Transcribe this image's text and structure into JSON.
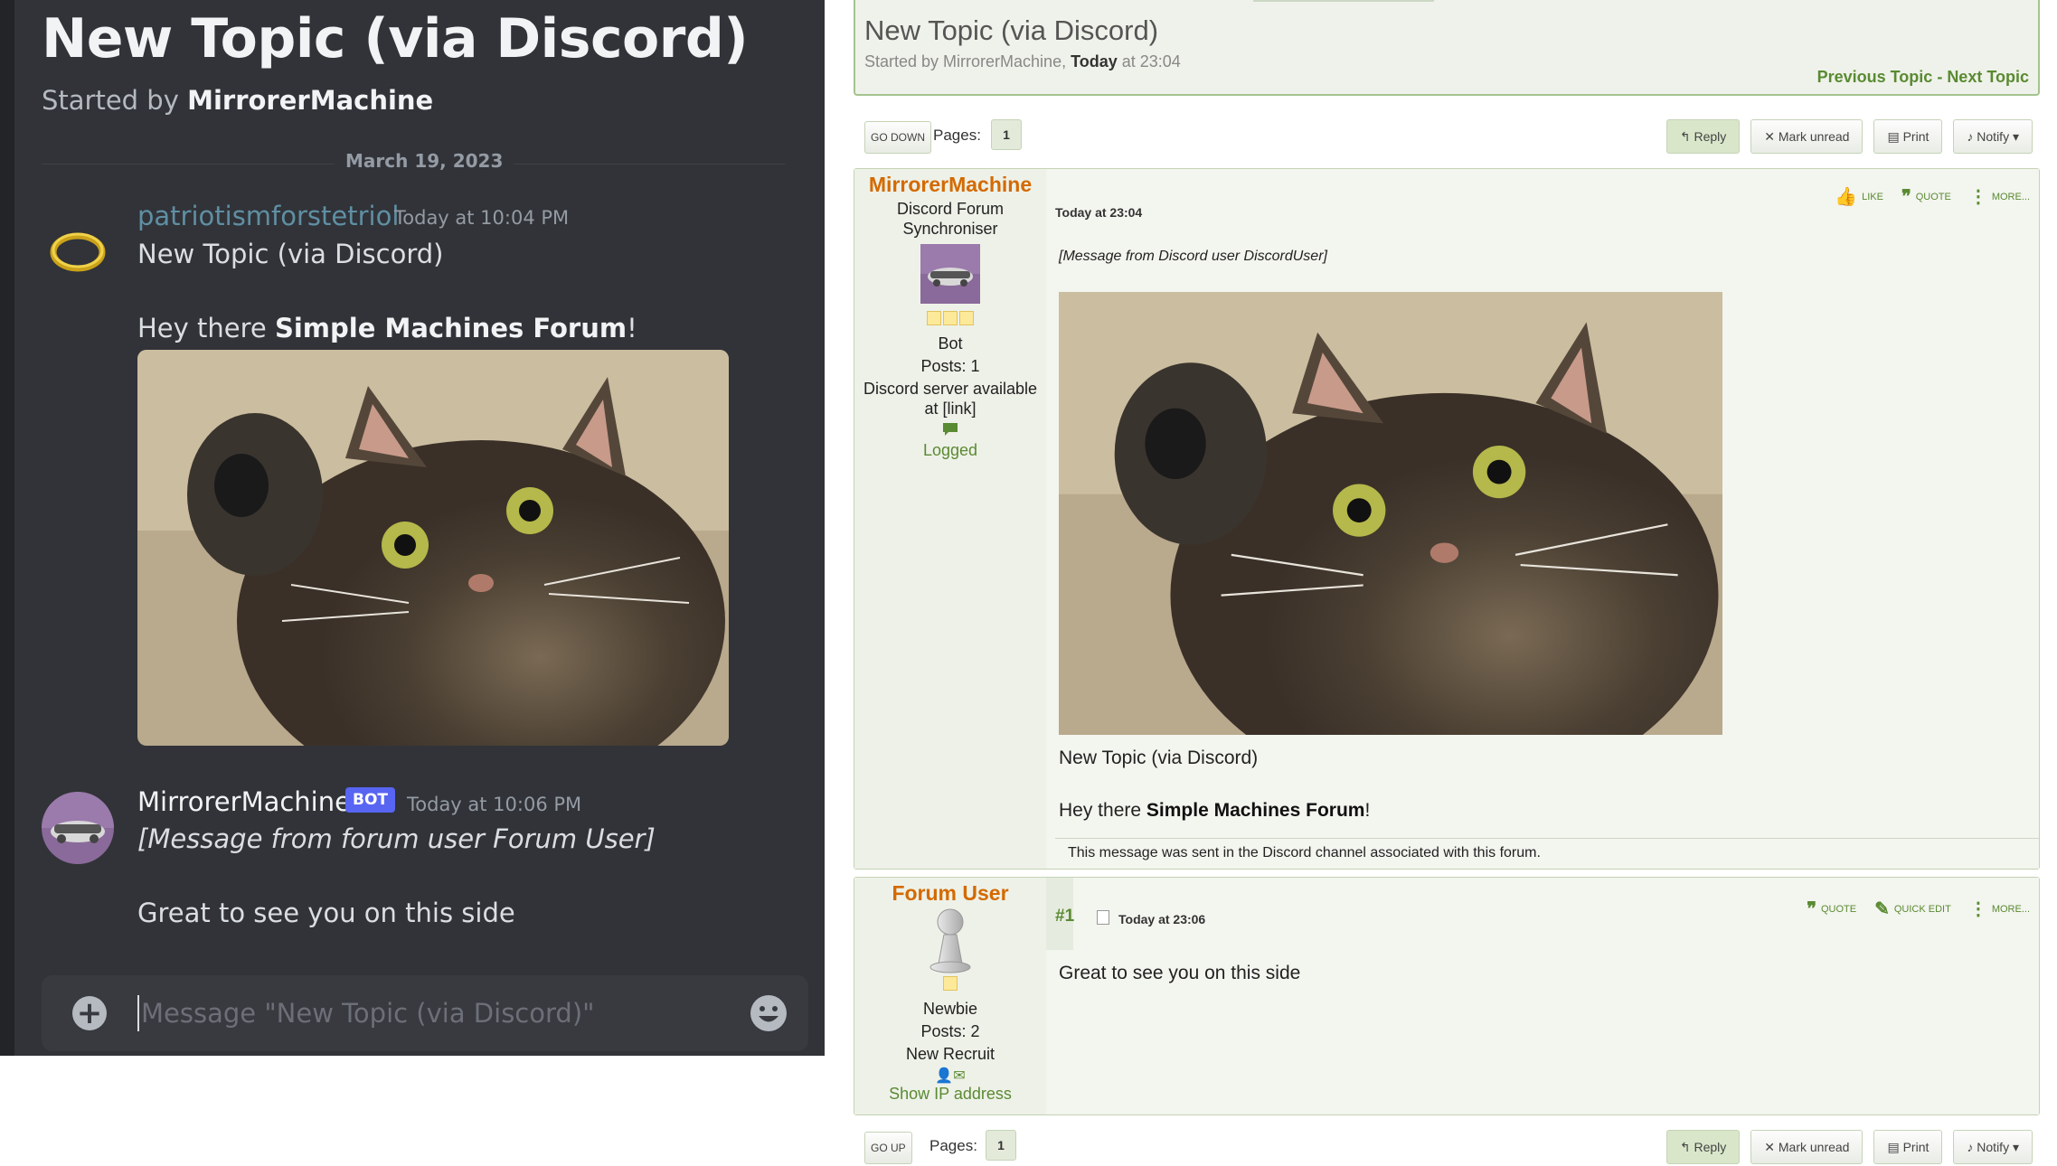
{
  "discord": {
    "title": "New Topic (via Discord)",
    "started_prefix": "Started by ",
    "started_user": "MirrorerMachine",
    "date_divider": "March 19, 2023",
    "messages": [
      {
        "user": "patriotismforstetriol",
        "user_color": "#5f8fa3",
        "time": "Today at 10:04 PM",
        "line1": "New Topic (via Discord)",
        "line2_prefix": "Hey there ",
        "line2_bold": "Simple Machines Forum",
        "line2_suffix": "!",
        "avatar_icon": "ring-icon"
      },
      {
        "user": "MirrorerMachine",
        "user_color": "#f2f3f5",
        "badge": "BOT",
        "time": "Today at 10:06 PM",
        "italic_line": "[Message from forum user Forum User]",
        "text": "Great to see you on this side",
        "avatar_icon": "machine-avatar-icon"
      }
    ],
    "input_placeholder": "Message \"New Topic (via Discord)\""
  },
  "forum": {
    "title": "New Topic (via Discord)",
    "started_prefix": "Started by MirrorerMachine, ",
    "started_bold": "Today",
    "started_suffix": " at 23:04",
    "prev_topic": "Previous Topic",
    "nav_sep": " - ",
    "next_topic": "Next Topic",
    "go_down": "GO DOWN",
    "go_up": "GO UP",
    "pages_label": "Pages:",
    "page_number": "1",
    "actions": {
      "reply": "Reply",
      "mark_unread": "Mark unread",
      "print": "Print",
      "notify": "Notify"
    },
    "post1": {
      "author": "MirrorerMachine",
      "title_line1": "Discord Forum",
      "title_line2": "Synchroniser",
      "group": "Bot",
      "posts": "Posts: 1",
      "sig1": "Discord server available",
      "sig2": "at [link]",
      "status": "Logged",
      "time": "Today at 23:04",
      "like": "LIKE",
      "quote": "QUOTE",
      "more": "MORE...",
      "italic": "[Message from Discord user DiscordUser]",
      "body1": "New Topic (via Discord)",
      "body2_prefix": "Hey there ",
      "body2_bold": "Simple Machines Forum",
      "body2_suffix": "!",
      "footer": "This message was sent in the Discord channel associated with this forum."
    },
    "post2": {
      "author": "Forum User",
      "group": "Newbie",
      "posts": "Posts: 2",
      "rank": "New Recruit",
      "show_ip": "Show IP address",
      "counter": "#1",
      "time": "Today at 23:06",
      "quote": "QUOTE",
      "quick_edit": "QUICK EDIT",
      "more": "MORE...",
      "body": "Great to see you on this side"
    }
  },
  "colors": {
    "discord_bg": "#313338",
    "forum_accent": "#5a8a32",
    "forum_author": "#d36a00",
    "bot_badge": "#5865f2"
  }
}
